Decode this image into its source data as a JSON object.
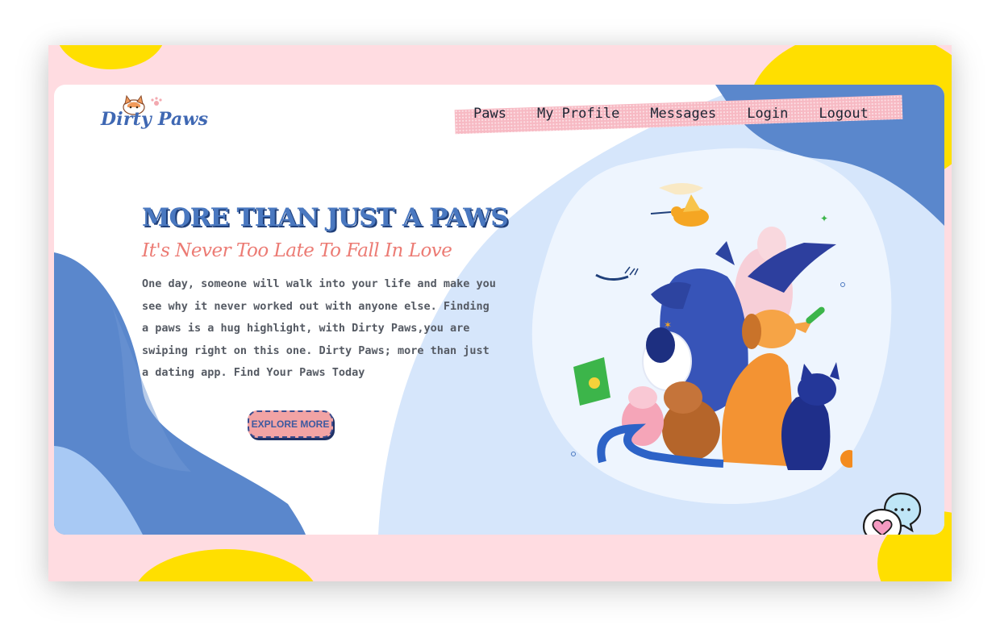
{
  "brand": {
    "name": "Dirty Paws",
    "logo_icon": "cat-paw-logo-icon"
  },
  "nav": {
    "items": [
      "Paws",
      "My Profile",
      "Messages",
      "Login",
      "Logout"
    ]
  },
  "hero": {
    "title": "MORE THAN JUST A PAWS",
    "subtitle": "It's Never Too Late To Fall In Love",
    "body": "One day, someone will walk into your life and make you see why it never worked out with anyone else. Finding a paws is a hug highlight, with Dirty Paws,you are swiping right on this one. Dirty Paws; more than just a dating app. Find Your Paws Today",
    "cta_label": "EXPLORE MORE",
    "illustration": "pets-group-illustration"
  },
  "chat_widget": {
    "icon": "chat-heart-icon",
    "typing_text": "..."
  },
  "colors": {
    "page_background": "#ffdce1",
    "accent_yellow": "#ffdf00",
    "brand_blue": "#4a78c0",
    "dark_blue": "#1f3f7a",
    "light_blue": "#d6e6fb",
    "coral": "#ec7b74",
    "nav_band": "#f7b9c3",
    "button_pink": "#f2a3a4"
  }
}
